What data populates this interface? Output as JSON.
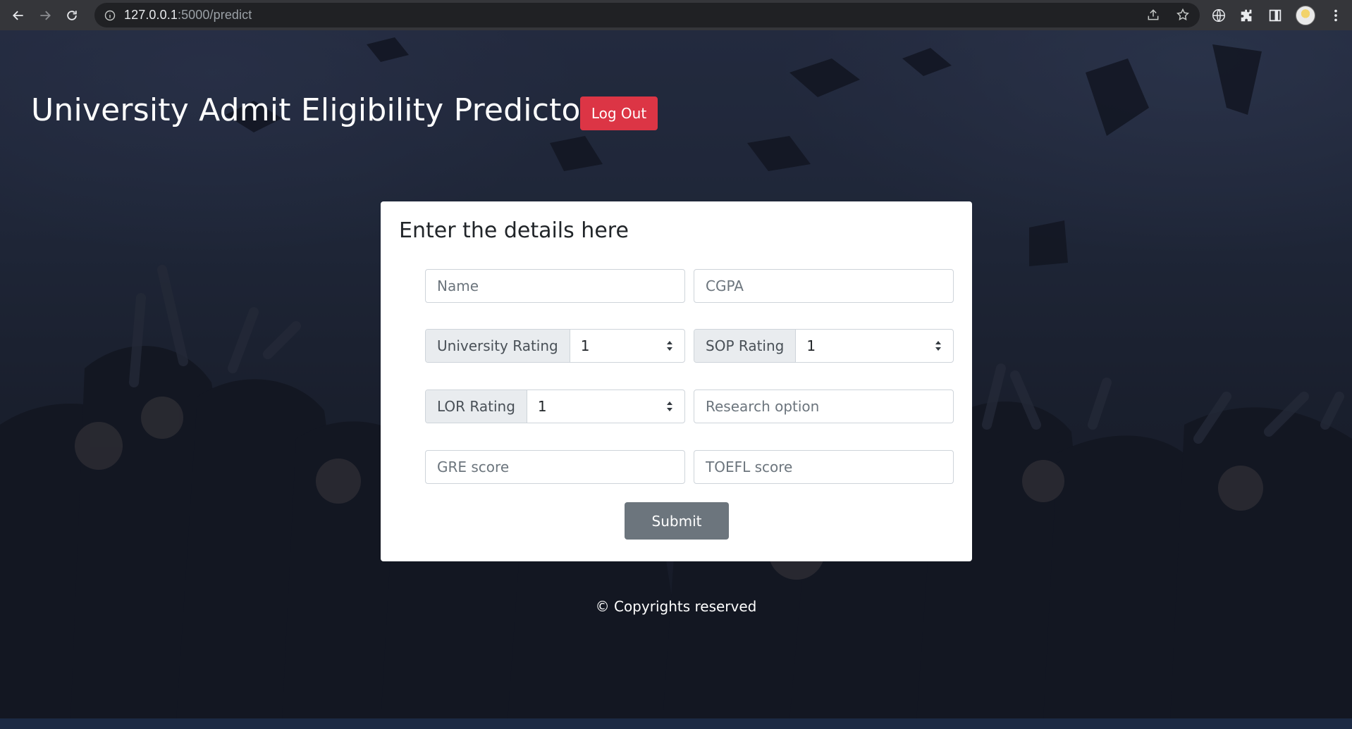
{
  "browser": {
    "url_host": "127.0.0.1",
    "url_path": ":5000/predict"
  },
  "header": {
    "title": "University Admit Eligibility Predictor",
    "logout_label": "Log Out"
  },
  "form": {
    "title": "Enter the details here",
    "name_placeholder": "Name",
    "cgpa_placeholder": "CGPA",
    "university_rating_label": "University Rating",
    "university_rating_value": "1",
    "sop_rating_label": "SOP Rating",
    "sop_rating_value": "1",
    "lor_rating_label": "LOR Rating",
    "lor_rating_value": "1",
    "research_placeholder": "Research option",
    "gre_placeholder": "GRE score",
    "toefl_placeholder": "TOEFL score",
    "submit_label": "Submit"
  },
  "footer": {
    "text": "© Copyrights reserved"
  },
  "colors": {
    "logout": "#dc3545",
    "submit": "#6c757d",
    "chrome": "#35363a"
  }
}
